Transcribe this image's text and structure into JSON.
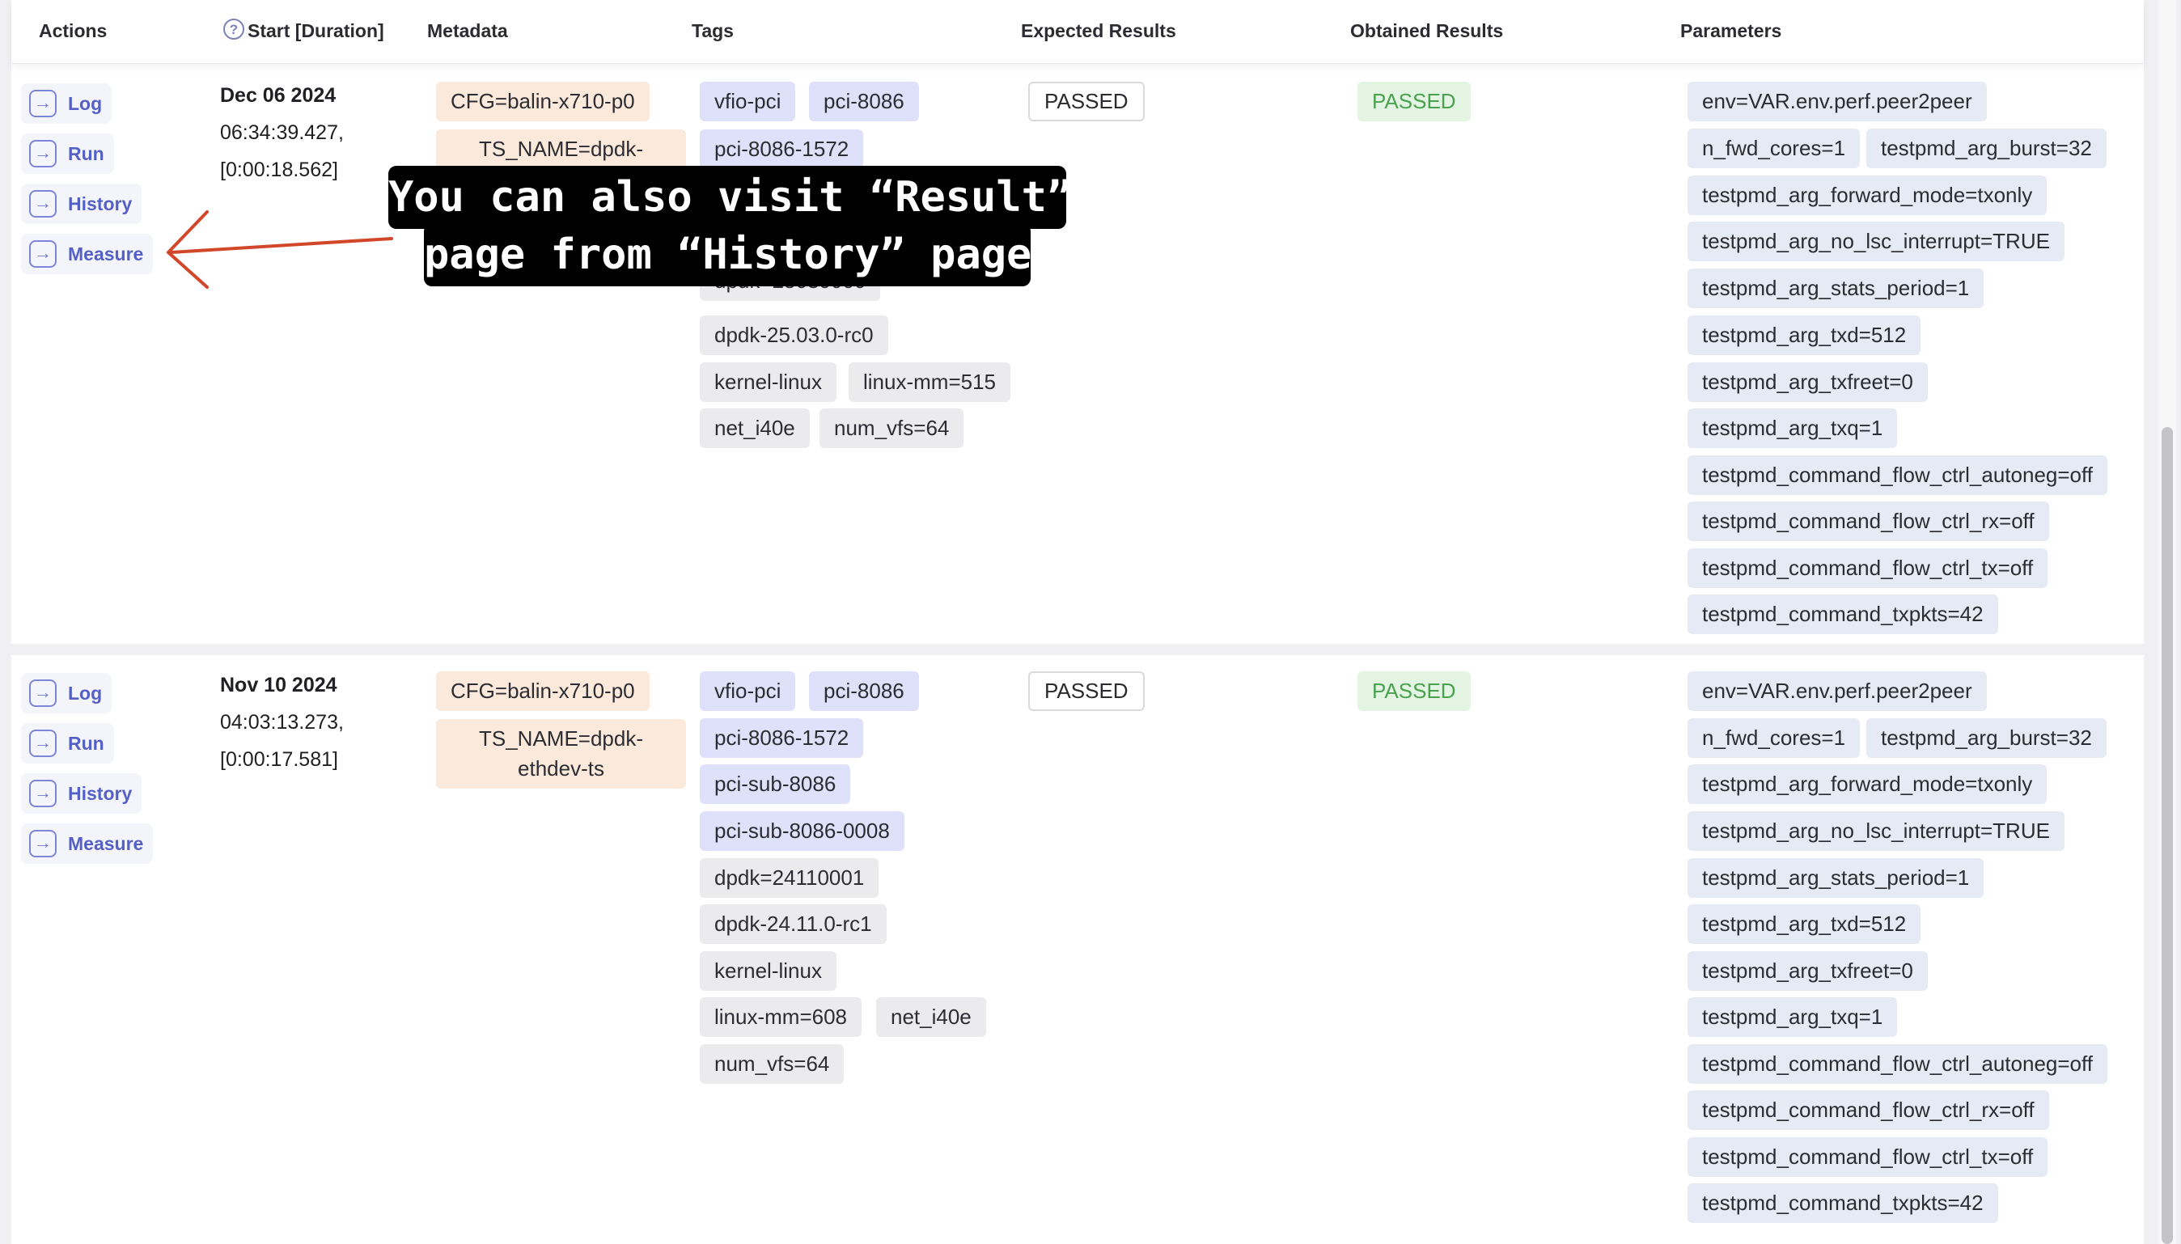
{
  "header": {
    "actions": "Actions",
    "start": "Start [Duration]",
    "metadata": "Metadata",
    "tags": "Tags",
    "expected": "Expected Results",
    "obtained": "Obtained Results",
    "parameters": "Parameters"
  },
  "icons": {
    "help": "help-circle-icon",
    "action": "arrow-right-box-icon"
  },
  "colors": {
    "action_text": "#5560c7",
    "passed_obtained": "#49a24e",
    "callout_bg": "#000000",
    "arrow": "#d2462a"
  },
  "rows": [
    {
      "actions": [
        "Log",
        "Run",
        "History",
        "Measure"
      ],
      "date": "Dec 06 2024",
      "time": "06:34:39.427,",
      "duration": "[0:00:18.562]",
      "metadata": [
        "CFG=balin-x710-p0",
        "TS_NAME=dpdk-"
      ],
      "tags": [
        "vfio-pci",
        "pci-8086",
        "pci-8086-1572",
        "dpdk=25030000",
        "dpdk-25.03.0-rc0",
        "kernel-linux",
        "linux-mm=515",
        "net_i40e",
        "num_vfs=64"
      ],
      "expected": "PASSED",
      "obtained": "PASSED",
      "parameters": [
        "env=VAR.env.perf.peer2peer",
        "n_fwd_cores=1",
        "testpmd_arg_burst=32",
        "testpmd_arg_forward_mode=txonly",
        "testpmd_arg_no_lsc_interrupt=TRUE",
        "testpmd_arg_stats_period=1",
        "testpmd_arg_txd=512",
        "testpmd_arg_txfreet=0",
        "testpmd_arg_txq=1",
        "testpmd_command_flow_ctrl_autoneg=off",
        "testpmd_command_flow_ctrl_rx=off",
        "testpmd_command_flow_ctrl_tx=off",
        "testpmd_command_txpkts=42"
      ]
    },
    {
      "actions": [
        "Log",
        "Run",
        "History",
        "Measure"
      ],
      "date": "Nov 10 2024",
      "time": "04:03:13.273,",
      "duration": "[0:00:17.581]",
      "metadata": [
        "CFG=balin-x710-p0",
        "TS_NAME=dpdk-",
        "ethdev-ts"
      ],
      "tags": [
        "vfio-pci",
        "pci-8086",
        "pci-8086-1572",
        "pci-sub-8086",
        "pci-sub-8086-0008",
        "dpdk=24110001",
        "dpdk-24.11.0-rc1",
        "kernel-linux",
        "linux-mm=608",
        "net_i40e",
        "num_vfs=64"
      ],
      "expected": "PASSED",
      "obtained": "PASSED",
      "parameters": [
        "env=VAR.env.perf.peer2peer",
        "n_fwd_cores=1",
        "testpmd_arg_burst=32",
        "testpmd_arg_forward_mode=txonly",
        "testpmd_arg_no_lsc_interrupt=TRUE",
        "testpmd_arg_stats_period=1",
        "testpmd_arg_txd=512",
        "testpmd_arg_txfreet=0",
        "testpmd_arg_txq=1",
        "testpmd_command_flow_ctrl_autoneg=off",
        "testpmd_command_flow_ctrl_rx=off",
        "testpmd_command_flow_ctrl_tx=off",
        "testpmd_command_txpkts=42"
      ]
    }
  ],
  "callout": {
    "line1": "You can also visit “Result”",
    "line2": "page from “History” page"
  }
}
